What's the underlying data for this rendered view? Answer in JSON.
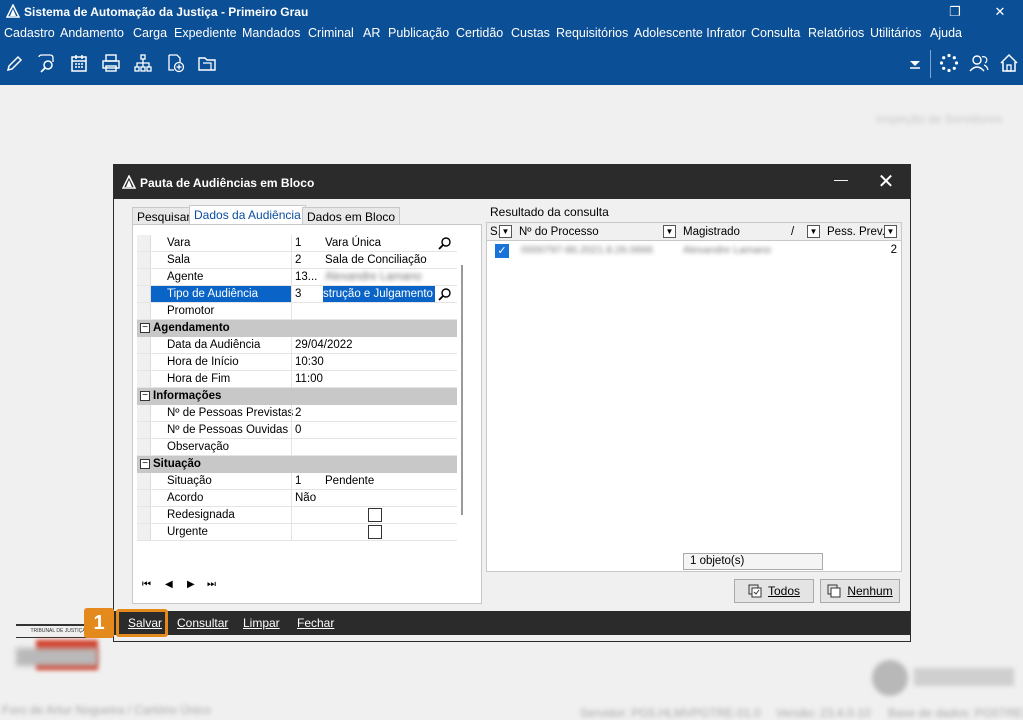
{
  "app": {
    "title": "Sistema de Automação da Justiça - Primeiro Grau",
    "menu": [
      "Cadastro",
      "Andamento",
      "Carga",
      "Expediente",
      "Mandados",
      "Criminal",
      "AR",
      "Publicação",
      "Certidão",
      "Custas",
      "Requisitórios",
      "Adolescente Infrator",
      "Consulta",
      "Relatórios",
      "Utilitários",
      "Ajuda"
    ],
    "toolbar_icons": [
      "edit-icon",
      "search-process-icon",
      "calendar-icon",
      "printer-icon",
      "hierarchy-icon",
      "add-document-icon",
      "folder-icon"
    ],
    "right_icons": [
      "dropdown-arrow-icon",
      "loading-icon",
      "users-icon",
      "home-icon"
    ]
  },
  "background": {
    "top_right_blurred": "Inspeção de Servidores",
    "footer_left": "Foro de Artur Nogueira / Cartório Único",
    "footer_server": "Servidor: PG5.HLMVPGTRE-01.0",
    "footer_version": "Versão: 23.4.0-10",
    "footer_db": "Base de dados: PG5TRE3",
    "logo_text": "TRIBUNAL DE JUSTIÇA"
  },
  "dialog": {
    "title": "Pauta de Audiências em Bloco",
    "tabs": [
      "Pesquisar",
      "Dados da Audiência",
      "Dados em Bloco"
    ],
    "active_tab": "Dados da Audiência",
    "fields": {
      "vara": {
        "label": "Vara",
        "code": "1",
        "desc": "Vara Única"
      },
      "sala": {
        "label": "Sala",
        "code": "2",
        "desc": "Sala de Conciliação"
      },
      "agente": {
        "label": "Agente",
        "code": "13...",
        "desc": "Alexandre Lamano"
      },
      "tipo": {
        "label": "Tipo de Audiência",
        "code": "3",
        "desc": "strução e Julgamento"
      },
      "promotor": {
        "label": "Promotor",
        "code": "",
        "desc": ""
      }
    },
    "agendamento": {
      "header": "Agendamento",
      "data_label": "Data da Audiência",
      "data": "29/04/2022",
      "inicio_label": "Hora de Início",
      "inicio": "10:30",
      "fim_label": "Hora de Fim",
      "fim": "11:00"
    },
    "informacoes": {
      "header": "Informações",
      "previstas_label": "Nº de Pessoas Previstas",
      "previstas": "2",
      "ouvidas_label": "Nº de Pessoas Ouvidas",
      "ouvidas": "0",
      "obs_label": "Observação",
      "obs": ""
    },
    "situacao": {
      "header": "Situação",
      "situacao_label": "Situação",
      "situacao_code": "1",
      "situacao_desc": "Pendente",
      "acordo_label": "Acordo",
      "acordo": "Não",
      "redesignada_label": "Redesignada",
      "urgente_label": "Urgente"
    },
    "nav": [
      "⏮",
      "◀",
      "▶",
      "⏭"
    ],
    "result": {
      "label": "Resultado da consulta",
      "columns": [
        "S.",
        "Nº do Processo",
        "Magistrado",
        "Pess. Prev."
      ],
      "sort_marker": "/",
      "rows": [
        {
          "processo": "0000797-86.2021.8.26.0666",
          "magistrado": "Alexandre Lamano",
          "prev": "2"
        }
      ],
      "count": "1 objeto(s)"
    },
    "buttons": {
      "todos": "Todos",
      "nenhum": "Nenhum"
    },
    "bottom": {
      "salvar": "Salvar",
      "consultar": "Consultar",
      "limpar": "Limpar",
      "fechar": "Fechar"
    }
  },
  "annotation": {
    "step": "1"
  }
}
